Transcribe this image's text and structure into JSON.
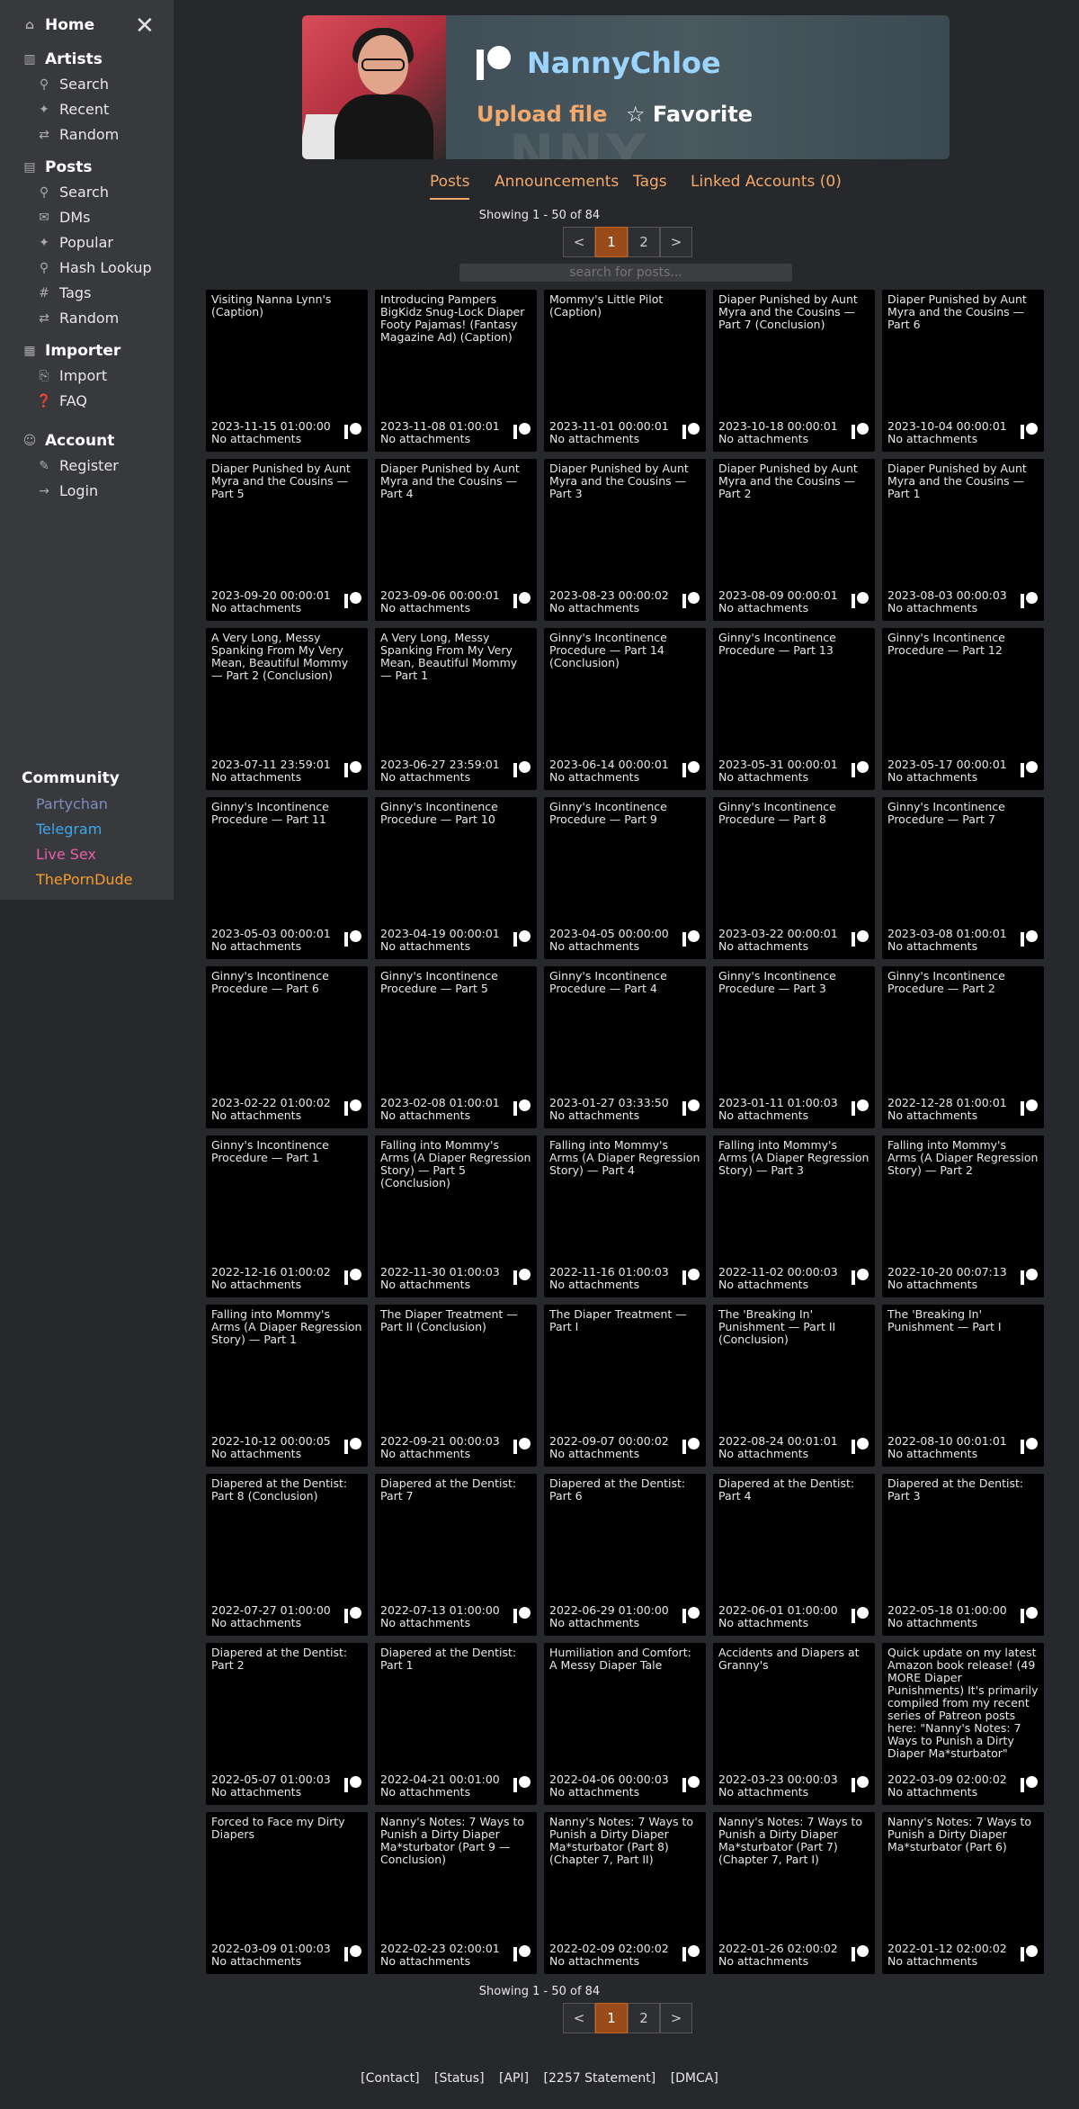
{
  "sidebar": {
    "home": "Home",
    "artists": {
      "title": "Artists",
      "items": [
        "Search",
        "Recent",
        "Random"
      ]
    },
    "posts": {
      "title": "Posts",
      "items": [
        "Search",
        "DMs",
        "Popular",
        "Hash Lookup",
        "Tags",
        "Random"
      ]
    },
    "importer": {
      "title": "Importer",
      "items": [
        "Import",
        "FAQ"
      ]
    },
    "account": {
      "title": "Account",
      "items": [
        "Register",
        "Login"
      ]
    },
    "community": {
      "title": "Community",
      "links": [
        {
          "label": "Partychan",
          "color": "#7e8dbf"
        },
        {
          "label": "Telegram",
          "color": "#3ea5e8"
        },
        {
          "label": "Live Sex",
          "color": "#e85ea8"
        },
        {
          "label": "ThePornDude",
          "color": "#f39c2a"
        }
      ]
    }
  },
  "header": {
    "creator_name": "NannyChloe",
    "upload": "Upload file",
    "favorite": "☆ Favorite",
    "banner_text": "NNY CHLOE'S"
  },
  "tabs": [
    "Posts",
    "Announcements",
    "Tags",
    "Linked Accounts (0)"
  ],
  "paginator": {
    "showing": "Showing 1 - 50 of 84",
    "prev": "<",
    "pages": [
      "1",
      "2"
    ],
    "next": ">"
  },
  "search": {
    "placeholder": "search for posts..."
  },
  "posts": [
    {
      "title": "Visiting Nanna Lynn's (Caption)",
      "date": "2023-11-15 01:00:00",
      "att": "No attachments"
    },
    {
      "title": "Introducing Pampers BigKidz Snug-Lock Diaper Footy Pajamas! (Fantasy Magazine Ad) (Caption)",
      "date": "2023-11-08 01:00:01",
      "att": "No attachments"
    },
    {
      "title": "Mommy's Little Pilot (Caption)",
      "date": "2023-11-01 00:00:01",
      "att": "No attachments"
    },
    {
      "title": "Diaper Punished by Aunt Myra and the Cousins — Part 7 (Conclusion)",
      "date": "2023-10-18 00:00:01",
      "att": "No attachments"
    },
    {
      "title": "Diaper Punished by Aunt Myra and the Cousins — Part 6",
      "date": "2023-10-04 00:00:01",
      "att": "No attachments"
    },
    {
      "title": "Diaper Punished by Aunt Myra and the Cousins — Part 5",
      "date": "2023-09-20 00:00:01",
      "att": "No attachments"
    },
    {
      "title": "Diaper Punished by Aunt Myra and the Cousins — Part 4",
      "date": "2023-09-06 00:00:01",
      "att": "No attachments"
    },
    {
      "title": "Diaper Punished by Aunt Myra and the Cousins — Part 3",
      "date": "2023-08-23 00:00:02",
      "att": "No attachments"
    },
    {
      "title": "Diaper Punished by Aunt Myra and the Cousins — Part 2",
      "date": "2023-08-09 00:00:01",
      "att": "No attachments"
    },
    {
      "title": "Diaper Punished by Aunt Myra and the Cousins — Part 1",
      "date": "2023-08-03 00:00:03",
      "att": "No attachments"
    },
    {
      "title": "A Very Long, Messy Spanking From My Very Mean, Beautiful Mommy — Part 2 (Conclusion)",
      "date": "2023-07-11 23:59:01",
      "att": "No attachments"
    },
    {
      "title": "A Very Long, Messy Spanking From My Very Mean, Beautiful Mommy — Part 1",
      "date": "2023-06-27 23:59:01",
      "att": "No attachments"
    },
    {
      "title": "Ginny's Incontinence Procedure — Part 14 (Conclusion)",
      "date": "2023-06-14 00:00:01",
      "att": "No attachments"
    },
    {
      "title": "Ginny's Incontinence Procedure — Part 13",
      "date": "2023-05-31 00:00:01",
      "att": "No attachments"
    },
    {
      "title": "Ginny's Incontinence Procedure — Part 12",
      "date": "2023-05-17 00:00:01",
      "att": "No attachments"
    },
    {
      "title": "Ginny's Incontinence Procedure — Part 11",
      "date": "2023-05-03 00:00:01",
      "att": "No attachments"
    },
    {
      "title": "Ginny's Incontinence Procedure — Part 10",
      "date": "2023-04-19 00:00:01",
      "att": "No attachments"
    },
    {
      "title": "Ginny's Incontinence Procedure — Part 9",
      "date": "2023-04-05 00:00:00",
      "att": "No attachments"
    },
    {
      "title": "Ginny's Incontinence Procedure — Part 8",
      "date": "2023-03-22 00:00:01",
      "att": "No attachments"
    },
    {
      "title": "Ginny's Incontinence Procedure — Part 7",
      "date": "2023-03-08 01:00:01",
      "att": "No attachments"
    },
    {
      "title": "Ginny's Incontinence Procedure — Part 6",
      "date": "2023-02-22 01:00:02",
      "att": "No attachments"
    },
    {
      "title": "Ginny's Incontinence Procedure — Part 5",
      "date": "2023-02-08 01:00:01",
      "att": "No attachments"
    },
    {
      "title": "Ginny's Incontinence Procedure — Part 4",
      "date": "2023-01-27 03:33:50",
      "att": "No attachments"
    },
    {
      "title": "Ginny's Incontinence Procedure — Part 3",
      "date": "2023-01-11 01:00:03",
      "att": "No attachments"
    },
    {
      "title": "Ginny's Incontinence Procedure — Part 2",
      "date": "2022-12-28 01:00:01",
      "att": "No attachments"
    },
    {
      "title": "Ginny's Incontinence Procedure — Part 1",
      "date": "2022-12-16 01:00:02",
      "att": "No attachments"
    },
    {
      "title": "Falling into Mommy's Arms (A Diaper Regression Story) — Part 5 (Conclusion)",
      "date": "2022-11-30 01:00:03",
      "att": "No attachments"
    },
    {
      "title": "Falling into Mommy's Arms (A Diaper Regression Story) — Part 4",
      "date": "2022-11-16 01:00:03",
      "att": "No attachments"
    },
    {
      "title": "Falling into Mommy's Arms (A Diaper Regression Story) — Part 3",
      "date": "2022-11-02 00:00:03",
      "att": "No attachments"
    },
    {
      "title": "Falling into Mommy's Arms (A Diaper Regression Story) — Part 2",
      "date": "2022-10-20 00:07:13",
      "att": "No attachments"
    },
    {
      "title": "Falling into Mommy's Arms (A Diaper Regression Story) — Part 1",
      "date": "2022-10-12 00:00:05",
      "att": "No attachments"
    },
    {
      "title": "The Diaper Treatment — Part II (Conclusion)",
      "date": "2022-09-21 00:00:03",
      "att": "No attachments"
    },
    {
      "title": "The Diaper Treatment — Part I",
      "date": "2022-09-07 00:00:02",
      "att": "No attachments"
    },
    {
      "title": "The 'Breaking In' Punishment — Part II (Conclusion)",
      "date": "2022-08-24 00:01:01",
      "att": "No attachments"
    },
    {
      "title": "The 'Breaking In' Punishment — Part I",
      "date": "2022-08-10 00:01:01",
      "att": "No attachments"
    },
    {
      "title": "Diapered at the Dentist: Part 8 (Conclusion)",
      "date": "2022-07-27 01:00:00",
      "att": "No attachments"
    },
    {
      "title": "Diapered at the Dentist: Part 7",
      "date": "2022-07-13 01:00:00",
      "att": "No attachments"
    },
    {
      "title": "Diapered at the Dentist: Part 6",
      "date": "2022-06-29 01:00:00",
      "att": "No attachments"
    },
    {
      "title": "Diapered at the Dentist: Part 4",
      "date": "2022-06-01 01:00:00",
      "att": "No attachments"
    },
    {
      "title": "Diapered at the Dentist: Part 3",
      "date": "2022-05-18 01:00:00",
      "att": "No attachments"
    },
    {
      "title": "Diapered at the Dentist: Part 2",
      "date": "2022-05-07 01:00:03",
      "att": "No attachments"
    },
    {
      "title": "Diapered at the Dentist: Part 1",
      "date": "2022-04-21 00:01:00",
      "att": "No attachments"
    },
    {
      "title": "Humiliation and Comfort: A Messy Diaper Tale",
      "date": "2022-04-06 00:00:03",
      "att": "No attachments"
    },
    {
      "title": "Accidents and Diapers at Granny's",
      "date": "2022-03-23 00:00:03",
      "att": "No attachments"
    },
    {
      "title": "Quick update on my latest Amazon book release! (49 MORE Diaper Punishments) It's primarily compiled from my recent series of Patreon posts here: \"Nanny's Notes: 7 Ways to Punish a Dirty Diaper Ma*sturbator\"",
      "date": "2022-03-09 02:00:02",
      "att": "No attachments"
    },
    {
      "title": "Forced to Face my Dirty Diapers",
      "date": "2022-03-09 01:00:03",
      "att": "No attachments"
    },
    {
      "title": "Nanny's Notes: 7 Ways to Punish a Dirty Diaper Ma*sturbator (Part 9 — Conclusion)",
      "date": "2022-02-23 02:00:01",
      "att": "No attachments"
    },
    {
      "title": "Nanny's Notes: 7 Ways to Punish a Dirty Diaper Ma*sturbator (Part 8) (Chapter 7, Part II)",
      "date": "2022-02-09 02:00:02",
      "att": "No attachments"
    },
    {
      "title": "Nanny's Notes: 7 Ways to Punish a Dirty Diaper Ma*sturbator (Part 7) (Chapter 7, Part I)",
      "date": "2022-01-26 02:00:02",
      "att": "No attachments"
    },
    {
      "title": "Nanny's Notes: 7 Ways to Punish a Dirty Diaper Ma*sturbator (Part 6)",
      "date": "2022-01-12 02:00:02",
      "att": "No attachments"
    }
  ],
  "footer": [
    "[Contact]",
    "[Status]",
    "[API]",
    "[2257 Statement]",
    "[DMCA]"
  ],
  "colors": {
    "accent": "#f3a96b",
    "creator_name": "#9ad4ff",
    "current_page": "#9a4b1a"
  }
}
